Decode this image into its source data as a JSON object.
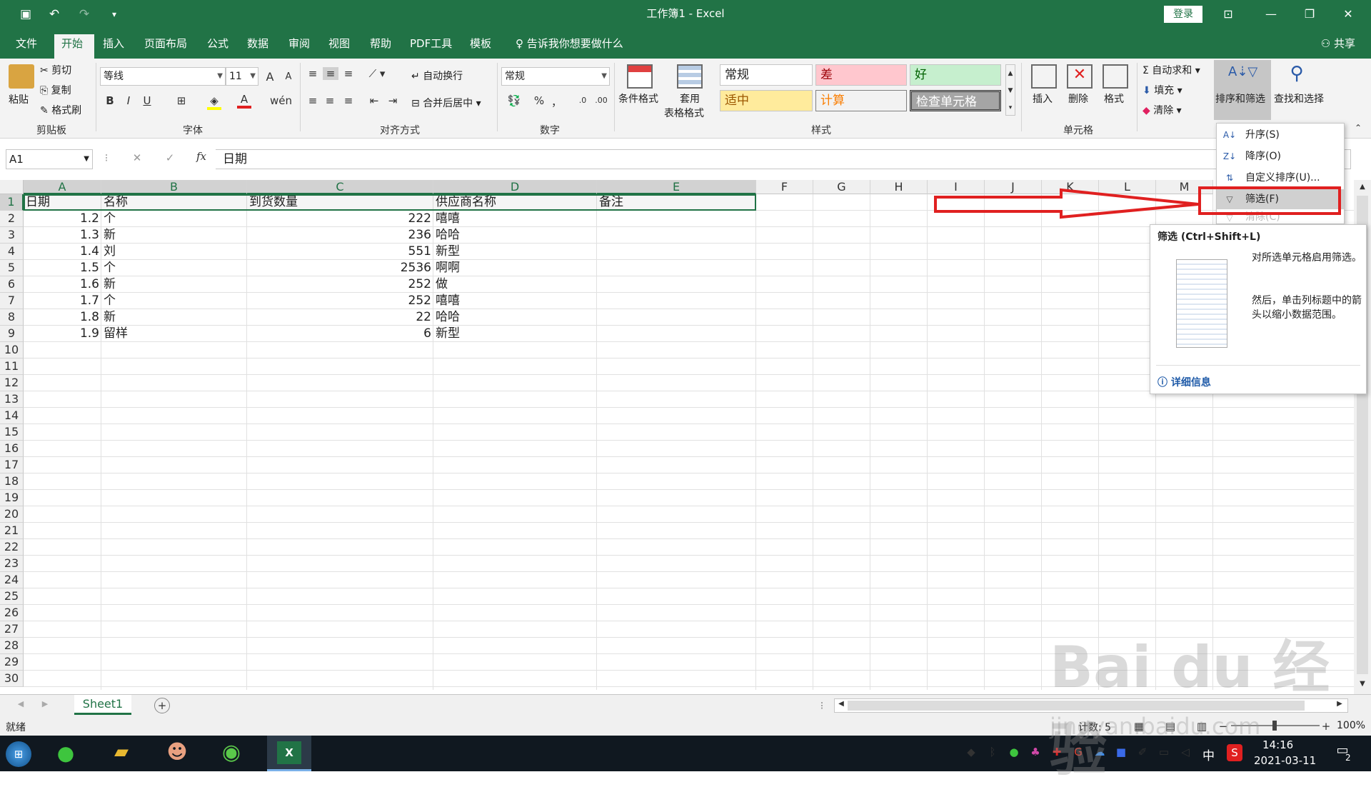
{
  "window": {
    "title": "工作簿1  -  Excel",
    "login": "登录"
  },
  "tabs": [
    "文件",
    "开始",
    "插入",
    "页面布局",
    "公式",
    "数据",
    "审阅",
    "视图",
    "帮助",
    "PDF工具",
    "模板"
  ],
  "tell_me": "告诉我你想要做什么",
  "share": "共享",
  "clipboard": {
    "paste": "粘贴",
    "cut": "剪切",
    "copy": "复制",
    "format_painter": "格式刷",
    "label": "剪贴板"
  },
  "font": {
    "name": "等线",
    "size": "11",
    "bold": "B",
    "italic": "I",
    "underline": "U",
    "label": "字体",
    "grow": "A",
    "shrink": "A",
    "color_glyph": "A"
  },
  "alignment": {
    "wrap": "自动换行",
    "merge": "合并后居中",
    "label": "对齐方式"
  },
  "number": {
    "format": "常规",
    "percent": "%",
    "comma": "，",
    "label": "数字"
  },
  "styles": {
    "conditional": "条件格式",
    "table_format_1": "套用",
    "table_format_2": "表格格式",
    "cells": [
      "常规",
      "差",
      "好",
      "适中",
      "计算",
      "检查单元格"
    ],
    "label": "样式"
  },
  "cells_group": {
    "insert": "插入",
    "delete": "删除",
    "format": "格式",
    "label": "单元格"
  },
  "editing": {
    "autosum": "自动求和",
    "fill": "填充",
    "clear": "清除",
    "sort_filter": "排序和筛选",
    "find_select": "查找和选择"
  },
  "name_box": "A1",
  "formula": "日期",
  "formula_fx": "fx",
  "columns": [
    "A",
    "B",
    "C",
    "D",
    "E",
    "F",
    "G",
    "H",
    "I",
    "J",
    "K",
    "L",
    "M"
  ],
  "rows": [
    "1",
    "2",
    "3",
    "4",
    "5",
    "6",
    "7",
    "8",
    "9",
    "10",
    "11",
    "12",
    "13",
    "14",
    "15",
    "16",
    "17",
    "18",
    "19",
    "20",
    "21",
    "22",
    "23",
    "24",
    "25",
    "26",
    "27",
    "28",
    "29",
    "30"
  ],
  "header_row": [
    "日期",
    "名称",
    "到货数量",
    "供应商名称",
    "备注"
  ],
  "data_rows": [
    [
      "1.2",
      "个",
      "222",
      "嘻嘻"
    ],
    [
      "1.3",
      "新",
      "236",
      "哈哈"
    ],
    [
      "1.4",
      "刘",
      "551",
      "新型"
    ],
    [
      "1.5",
      "个",
      "2536",
      "啊啊"
    ],
    [
      "1.6",
      "新",
      "252",
      "做"
    ],
    [
      "1.7",
      "个",
      "252",
      "嘻嘻"
    ],
    [
      "1.8",
      "新",
      "22",
      "哈哈"
    ],
    [
      "1.9",
      "留样",
      "6",
      "新型"
    ]
  ],
  "dropdown": [
    {
      "label": "升序(S)",
      "icon": "sort-ascending-icon"
    },
    {
      "label": "降序(O)",
      "icon": "sort-descending-icon"
    },
    {
      "label": "自定义排序(U)...",
      "icon": "custom-sort-icon"
    },
    {
      "label": "筛选(F)",
      "icon": "filter-icon"
    },
    {
      "label": "清除(C)",
      "icon": "clear-filter-icon"
    }
  ],
  "tooltip": {
    "title": "筛选 (Ctrl+Shift+L)",
    "desc1": "对所选单元格启用筛选。",
    "desc2": "然后，单击列标题中的箭头以缩小数据范围。",
    "more": "详细信息"
  },
  "sheet_tab": "Sheet1",
  "status": {
    "ready": "就绪",
    "count": "计数: 5",
    "zoom": "100%"
  },
  "taskbar": {
    "time": "14:16",
    "date": "2021-03-11",
    "ime": "中",
    "notifications": "2"
  },
  "watermark": {
    "main": "Bai du 经验",
    "url": "jingyan.baidu.com"
  },
  "colors": {
    "excel_green": "#217346",
    "bad_fill": "#ffc7ce",
    "good_fill": "#c6efce",
    "neutral_fill": "#ffeb9c",
    "annotation_red": "#e02020"
  }
}
